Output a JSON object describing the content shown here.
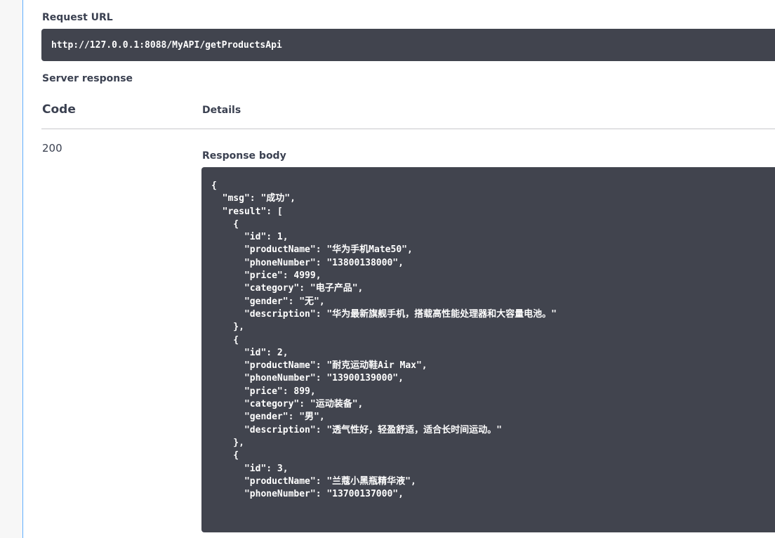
{
  "request_url": {
    "label": "Request URL",
    "value": "http://127.0.0.1:8088/MyAPI/getProductsApi"
  },
  "server_response": {
    "label": "Server response",
    "columns": {
      "code": "Code",
      "details": "Details"
    },
    "status_code": "200",
    "response_body_label": "Response body",
    "body_lines": [
      "{",
      "  \"msg\": \"成功\",",
      "  \"result\": [",
      "    {",
      "      \"id\": 1,",
      "      \"productName\": \"华为手机Mate50\",",
      "      \"phoneNumber\": \"13800138000\",",
      "      \"price\": 4999,",
      "      \"category\": \"电子产品\",",
      "      \"gender\": \"无\",",
      "      \"description\": \"华为最新旗舰手机，搭载高性能处理器和大容量电池。\"",
      "    },",
      "    {",
      "      \"id\": 2,",
      "      \"productName\": \"耐克运动鞋Air Max\",",
      "      \"phoneNumber\": \"13900139000\",",
      "      \"price\": 899,",
      "      \"category\": \"运动装备\",",
      "      \"gender\": \"男\",",
      "      \"description\": \"透气性好，轻盈舒适，适合长时间运动。\"",
      "    },",
      "    {",
      "      \"id\": 3,",
      "      \"productName\": \"兰蔻小黑瓶精华液\",",
      "      \"phoneNumber\": \"13700137000\","
    ]
  }
}
